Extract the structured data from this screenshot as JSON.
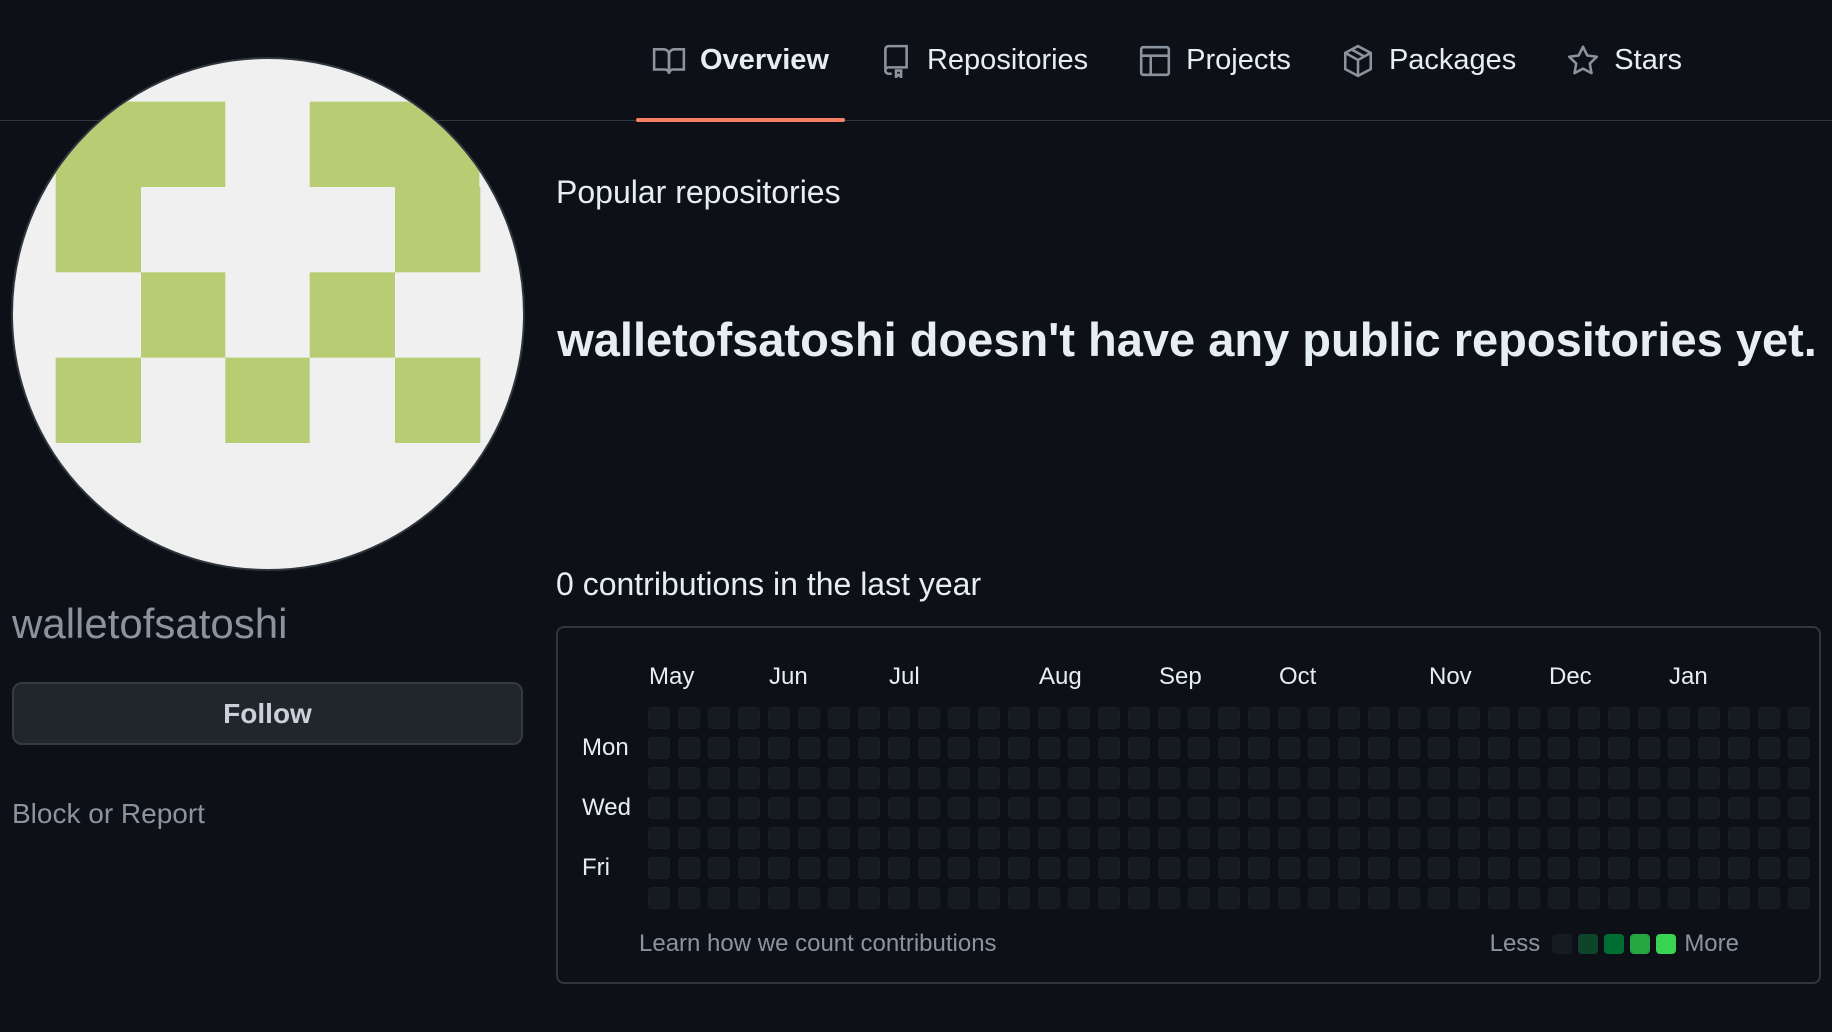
{
  "nav": {
    "tabs": [
      {
        "label": "Overview",
        "icon": "book-icon",
        "active": true
      },
      {
        "label": "Repositories",
        "icon": "repo-icon",
        "active": false
      },
      {
        "label": "Projects",
        "icon": "table-icon",
        "active": false
      },
      {
        "label": "Packages",
        "icon": "package-icon",
        "active": false
      },
      {
        "label": "Stars",
        "icon": "star-icon",
        "active": false
      }
    ],
    "active_underline_color": "#f78166"
  },
  "profile": {
    "username": "walletofsatoshi",
    "follow_label": "Follow",
    "block_label": "Block or Report",
    "avatar_color": "#b8cc73",
    "avatar_bg": "#f0f0f0"
  },
  "popular": {
    "title": "Popular repositories",
    "empty_message": "walletofsatoshi doesn't have any public repositories yet."
  },
  "contributions": {
    "title": "0 contributions in the last year",
    "months": [
      "May",
      "Jun",
      "Jul",
      "Aug",
      "Sep",
      "Oct",
      "Nov",
      "Dec",
      "Jan"
    ],
    "days": [
      "Mon",
      "Wed",
      "Fri"
    ],
    "learn_link": "Learn how we count contributions",
    "legend_less": "Less",
    "legend_more": "More",
    "legend_colors": [
      "#161b22",
      "#0e4429",
      "#006d32",
      "#26a641",
      "#39d353"
    ],
    "total": 0
  }
}
